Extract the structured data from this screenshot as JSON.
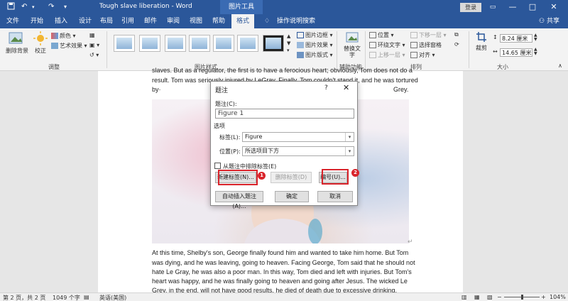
{
  "titlebar": {
    "doc_title": "Tough slave liberation  -  Word",
    "tools_tab": "图片工具",
    "login": "登录",
    "minimize": "—",
    "restore": "□",
    "close": "✕",
    "save_icon": "save-icon",
    "undo_icon": "undo-icon"
  },
  "tabs": [
    {
      "label": "文件"
    },
    {
      "label": "开始"
    },
    {
      "label": "插入"
    },
    {
      "label": "设计"
    },
    {
      "label": "布局"
    },
    {
      "label": "引用"
    },
    {
      "label": "邮件"
    },
    {
      "label": "审阅"
    },
    {
      "label": "视图"
    },
    {
      "label": "帮助"
    },
    {
      "label": "格式"
    },
    {
      "label": "操作说明搜索"
    }
  ],
  "share": "共享",
  "ribbon": {
    "remove_bg": "删除背景",
    "correct": "校正",
    "color": "颜色",
    "art_effects": "艺术效果",
    "adjust_group": "调整",
    "styles_group": "图片样式",
    "border": "图片边框",
    "effects": "图片效果",
    "layout": "图片版式",
    "alt_text": "替换文字",
    "accessibility_group": "辅助功能",
    "position": "位置",
    "wrap_text": "环绕文字",
    "bring_forward": "上移一层",
    "send_backward": "下移一层",
    "selection_pane": "选择窗格",
    "align": "对齐",
    "arrange_group": "排列",
    "crop": "裁剪",
    "height": "8.24 厘米",
    "width": "14.65 厘米",
    "size_group": "大小"
  },
  "document": {
    "line1": "slaves. But as a regulator, the first is to have a ferocious heart; obviously, Tom does not do a",
    "line2": "result. Tom was seriously injured by LeGray. Finally, Tom couldn't stand it, and he was tortured",
    "line3a": "by·",
    "line3b": "Grey.",
    "para1": "At this time, Shelby's son, George finally found him and wanted to take him home. But Tom",
    "para2": "was dying, and he was leaving, going to heaven. Facing George, Tom said that he should not",
    "para3": "hate Le Gray, he was also a poor man. In this way, Tom died and left with injuries. But Tom's",
    "para4": "heart was happy, and he was finally going to heaven and going after Jesus. The wicked Le",
    "para5": "Grey, in the end, will not have good results, he died of death due to excessive drinking.",
    "para_mark": "↵"
  },
  "dialog": {
    "title": "题注",
    "help": "?",
    "close": "✕",
    "caption_label": "题注(C):",
    "caption_value": "Figure 1",
    "options_label": "选项",
    "label_label": "标签(L):",
    "label_value": "Figure",
    "position_label": "位置(P):",
    "position_value": "所选项目下方",
    "exclude_label": "从题注中排除标签(E)",
    "new_label_btn": "新建标签(N)...",
    "delete_label_btn": "删除标签(D)",
    "numbering_btn": "编号(U)...",
    "autocaption_btn": "自动插入题注(A)...",
    "ok_btn": "确定",
    "cancel_btn": "取消",
    "marker1": "1",
    "marker2": "2"
  },
  "status": {
    "page": "第 2 页，共 2 页",
    "words": "1049 个字",
    "language": "英语(美国)",
    "zoom_minus": "−",
    "zoom_plus": "+",
    "zoom": "104%"
  },
  "colors": {
    "accent": "#2b579a",
    "highlight": "#d9242b"
  }
}
